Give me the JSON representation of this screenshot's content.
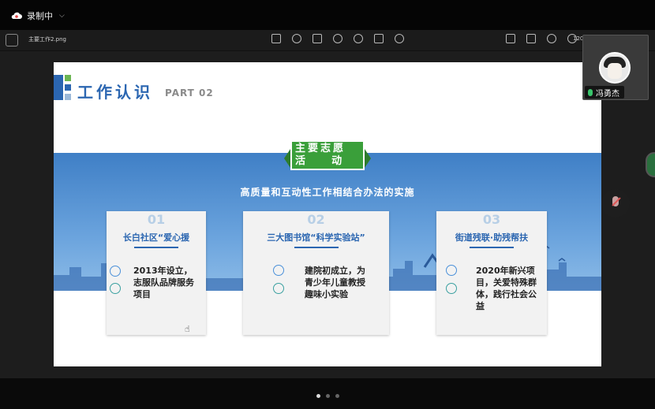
{
  "recording": {
    "label": "录制中"
  },
  "viewer": {
    "filename": "主要工作2.png",
    "zoom": "120"
  },
  "slide": {
    "title": "工作认识",
    "part": "PART 02",
    "ribbon": {
      "line1": "主要志愿",
      "line2": "活    动"
    },
    "subtitle": "高质量和互动性工作相结合办法的实施",
    "cards": [
      {
        "num": "01",
        "title": "长白社区“爱心援",
        "text": "2013年设立，志服队品牌服务项目"
      },
      {
        "num": "02",
        "title": "三大图书馆“科学实验站”",
        "text": "建院初成立，为青少年儿童教授趣味小实验"
      },
      {
        "num": "03",
        "title": "街道残联·助残帮扶",
        "text": "2020年新兴项目，关爱特殊群体，践行社会公益"
      }
    ]
  },
  "participant": {
    "name": "冯勇杰"
  },
  "pager": {
    "count": 3,
    "active": 0
  },
  "colors": {
    "accent_blue": "#2b66b1",
    "ribbon_green": "#3a9f3a",
    "mic_green": "#39c46b"
  }
}
